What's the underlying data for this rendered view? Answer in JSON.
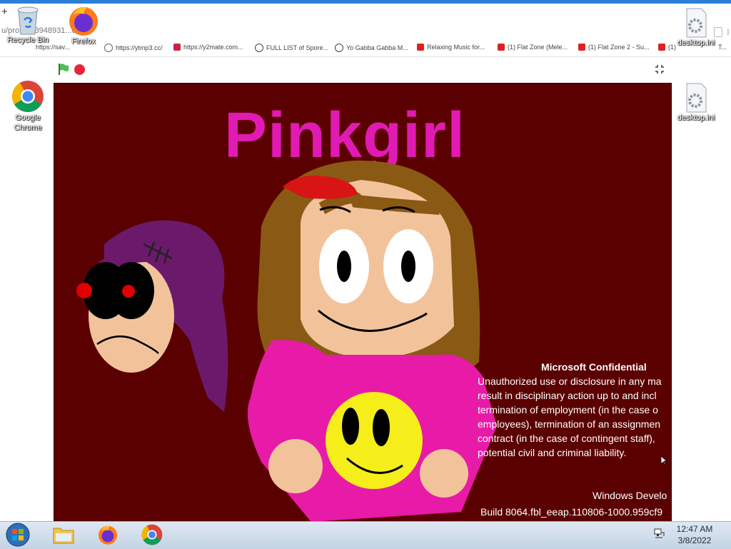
{
  "browser": {
    "newtab_glyph": "+",
    "url": "u/pro...653948931...en/",
    "bookmarks": [
      {
        "label": "https://sav...",
        "color": "#3a7bd5"
      },
      {
        "label": "https://ytmp3.cc/",
        "color": "#555555"
      },
      {
        "label": "https://y2mate.com...",
        "color": "#cc2244"
      },
      {
        "label": "FULL LIST of Spore...",
        "color": "#444444"
      },
      {
        "label": "Yo Gabba Gabba M...",
        "color": "#444444"
      },
      {
        "label": "Relaxing Music for...",
        "color": "#e02020"
      },
      {
        "label": "(1) Flat Zone (Mele...",
        "color": "#e02020"
      },
      {
        "label": "(1) Flat Zone 2 - Su...",
        "color": "#e02020"
      },
      {
        "label": "(1)",
        "color": "#e02020"
      }
    ],
    "right_bookmark_tail": "T..."
  },
  "stage": {
    "title": "Pinkgirl",
    "title_color": "#e01ab3",
    "background": "#5b0000"
  },
  "watermark": {
    "heading": "Microsoft Confidential",
    "lines": [
      "Unauthorized use or disclosure in any ma",
      "result in disciplinary action up to and incl",
      "termination of employment (in the case o",
      "employees), termination of an assignmen",
      "contract (in the case of contingent staff),",
      "potential civil and criminal liability."
    ],
    "edition": "Windows Develo",
    "build": "Build 8064.fbl_eeap.110806-1000.959cf9"
  },
  "desktop": {
    "icons": [
      {
        "label": "Recycle Bin"
      },
      {
        "label": "Firefox"
      },
      {
        "label": "Google Chrome"
      },
      {
        "label": "desktop.ini"
      },
      {
        "label": "desktop.ini"
      }
    ]
  },
  "taskbar": {
    "time": "12:47 AM",
    "date": "3/8/2022"
  }
}
